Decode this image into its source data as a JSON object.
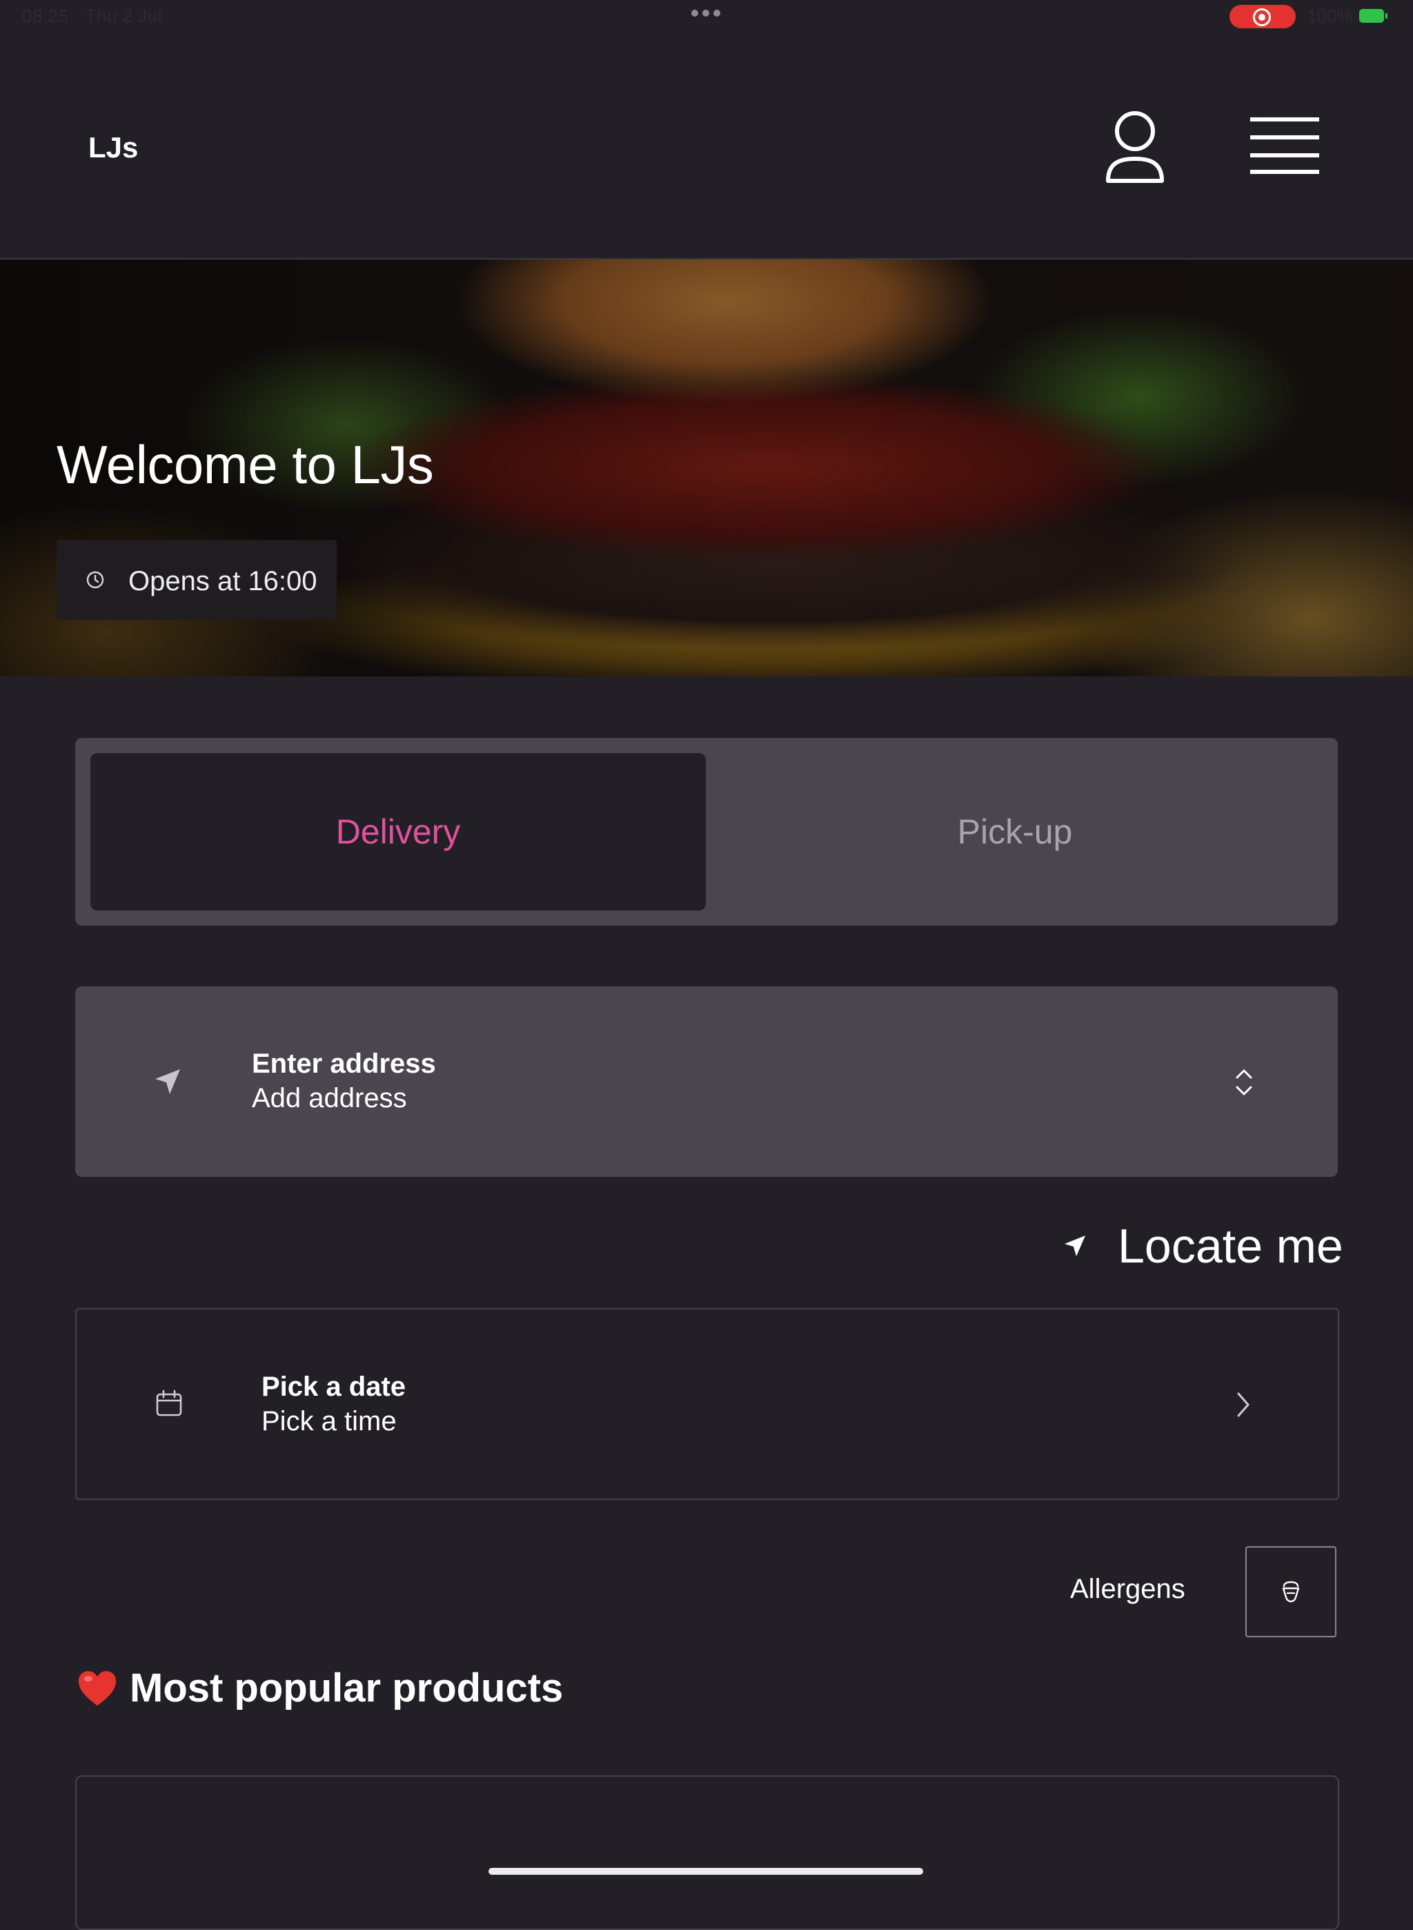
{
  "status_bar": {
    "time": "08:25",
    "date": "Thu 2 Jul",
    "battery": "100%"
  },
  "header": {
    "logo": "LJs"
  },
  "hero": {
    "title": "Welcome to  LJs",
    "opening_text": "Opens at 16:00"
  },
  "order_type": {
    "tabs": [
      {
        "label": "Delivery",
        "selected": true
      },
      {
        "label": "Pick-up",
        "selected": false
      }
    ],
    "accent_color": "#e0529c"
  },
  "address": {
    "label": "Enter address",
    "value": "Add address"
  },
  "locate": {
    "label": "Locate me"
  },
  "schedule": {
    "date_label": "Pick a date",
    "time_label": "Pick a time"
  },
  "allergens": {
    "label": "Allergens"
  },
  "popular": {
    "title": "Most popular products"
  },
  "icons": [
    "user-icon",
    "menu-icon",
    "clock-icon",
    "navigation-arrow-icon",
    "chevron-up-down-icon",
    "calendar-icon",
    "chevron-right-icon",
    "allergen-icon",
    "heart-icon"
  ]
}
